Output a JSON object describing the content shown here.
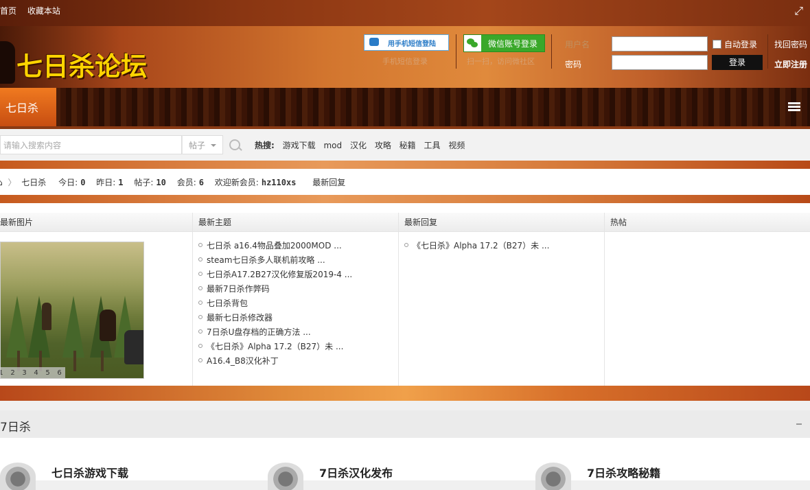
{
  "topbar": {
    "home": "设为首页",
    "favorite": "收藏本站"
  },
  "logo": {
    "text": "七日杀论坛"
  },
  "login": {
    "sms_button": "用手机短信登陆",
    "sms_sub": "手机短信登录",
    "wechat_button": "微信账号登录",
    "wechat_sub": "扫一扫，访问微社区",
    "username_label": "用户名",
    "password_label": "密码",
    "auto_login": "自动登录",
    "submit": "登录",
    "find_password": "找回密码",
    "register": "立即注册"
  },
  "nav": {
    "active": "七日杀"
  },
  "search": {
    "placeholder": "请输入搜索内容",
    "type": "帖子",
    "hot_label": "热搜:",
    "hot": [
      "游戏下载",
      "mod",
      "汉化",
      "攻略",
      "秘籍",
      "工具",
      "视频"
    ]
  },
  "stats": {
    "forum": "七日杀",
    "today_label": "今日:",
    "today": "0",
    "yesterday_label": "昨日:",
    "yesterday": "1",
    "posts_label": "帖子:",
    "posts": "10",
    "members_label": "会员:",
    "members": "6",
    "welcome_label": "欢迎新会员:",
    "new_member": "hz110xs",
    "latest_reply": "最新回复"
  },
  "panel": {
    "col1": "最新图片",
    "col2": "最新主题",
    "col3": "最新回复",
    "col4": "热帖",
    "latest_topics": [
      "七日杀 a16.4物品叠加2000MOD ...",
      "steam七日杀多人联机前攻略 ...",
      "七日杀A17.2B27汉化修复版2019-4 ...",
      "最新7日杀作弊码",
      "七日杀背包",
      "最新七日杀修改器",
      "7日杀U盘存档的正确方法 ...",
      "《七日杀》Alpha 17.2（B27）未 ...",
      "A16.4_B8汉化补丁"
    ],
    "latest_replies": [
      "《七日杀》Alpha 17.2（B27）未 ..."
    ],
    "pager": [
      "1",
      "2",
      "3",
      "4",
      "5",
      "6"
    ]
  },
  "section": {
    "title": "7日杀"
  },
  "forums": [
    "七日杀游戏下载",
    "7日杀汉化发布",
    "7日杀攻略秘籍"
  ]
}
